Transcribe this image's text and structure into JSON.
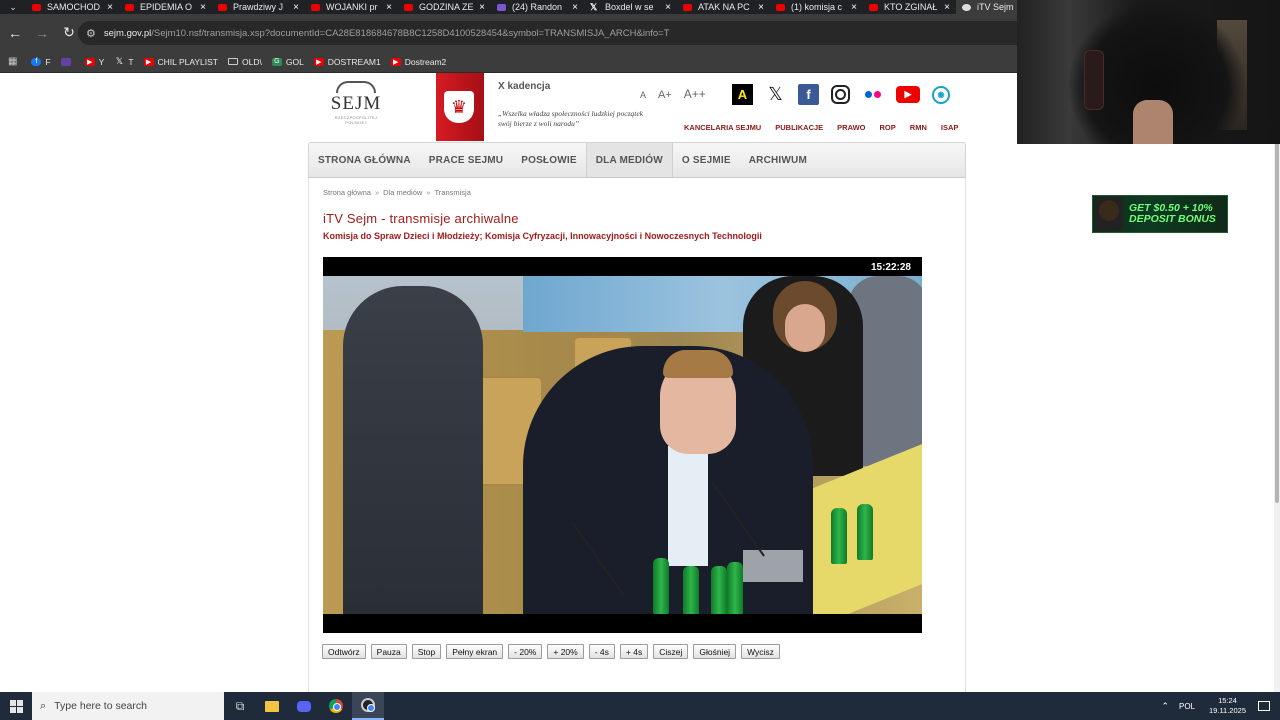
{
  "browser": {
    "tabs": [
      {
        "title": "SAMOCHOD",
        "icon": "youtube-icon"
      },
      {
        "title": "EPIDEMIA O",
        "icon": "youtube-icon"
      },
      {
        "title": "Prawdziwy J",
        "icon": "youtube-icon"
      },
      {
        "title": "WOJANKI pr",
        "icon": "youtube-icon"
      },
      {
        "title": "GODZINA ZE",
        "icon": "youtube-icon"
      },
      {
        "title": "(24) Randon",
        "icon": "twitch-icon"
      },
      {
        "title": "Boxdel w se",
        "icon": "x-icon"
      },
      {
        "title": "ATAK NA PC",
        "icon": "youtube-icon"
      },
      {
        "title": "(1) komisja c",
        "icon": "youtube-icon"
      },
      {
        "title": "KTO ZGINAŁ",
        "icon": "youtube-icon"
      },
      {
        "title": "iTV Sejm",
        "icon": "sejm-icon"
      }
    ],
    "url_host": "sejm.gov.pl",
    "url_path": "/Sejm10.nsf/transmisja.xsp?documentId=CA28E818684678B8C1258D4100528454&symbol=TRANSMISJA_ARCH&info=T",
    "bookmarks": [
      {
        "label": "F",
        "icon": "facebook-icon"
      },
      {
        "label": "",
        "icon": "twitch-icon"
      },
      {
        "label": "Y",
        "icon": "youtube-icon"
      },
      {
        "label": "T",
        "icon": "x-icon"
      },
      {
        "label": "CHIL PLAYLIST",
        "icon": "youtube-icon"
      },
      {
        "label": "OLD\\",
        "icon": "folder-icon"
      },
      {
        "label": "GOL",
        "icon": "gol-icon"
      },
      {
        "label": "DOSTREAM1",
        "icon": "youtube-icon"
      },
      {
        "label": "Dostream2",
        "icon": "youtube-icon"
      }
    ]
  },
  "header": {
    "logo_text": "SEJM",
    "logo_sub": "RZECZPOSPOLITEJ POLSKIEJ",
    "kadencja": "X kadencja",
    "motto": "„Wszelka władza społeczności ludzkiej początek swój bierze z woli narodu”",
    "font_sizes": [
      "A",
      "A+",
      "A++"
    ],
    "social": [
      "contrast-icon",
      "x-icon",
      "facebook-icon",
      "instagram-icon",
      "flickr-icon",
      "youtube-icon",
      "wz-icon"
    ],
    "top_links": [
      "KANCELARIA SEJMU",
      "PUBLIKACJE",
      "PRAWO",
      "ROP",
      "RMN",
      "ISAP"
    ]
  },
  "nav": {
    "items": [
      "STRONA GŁÓWNA",
      "PRACE SEJMU",
      "POSŁOWIE",
      "DLA MEDIÓW",
      "O SEJMIE",
      "ARCHIWUM"
    ],
    "active": "DLA MEDIÓW"
  },
  "main": {
    "breadcrumb": [
      "Strona główna",
      "Dla mediów",
      "Transmisja"
    ],
    "title": "iTV Sejm - transmisje archiwalne",
    "subtitle": "Komisja do Spraw Dzieci i Młodzieży; Komisja Cyfryzacji, Innowacyjności i Nowoczesnych Technologii",
    "timecode": "15:22:28",
    "controls": [
      "Odtwórz",
      "Pauza",
      "Stop",
      "Pełny ekran",
      "- 20%",
      "+ 20%",
      "- 4s",
      "+ 4s",
      "Ciszej",
      "Głośniej",
      "Wycisz"
    ]
  },
  "ad": {
    "line1": "GET $0.50 + 10%",
    "line2": "DEPOSIT BONUS"
  },
  "taskbar": {
    "search_placeholder": "Type here to search",
    "lang": "POL",
    "time": "15:24",
    "date": "19.11.2025"
  }
}
